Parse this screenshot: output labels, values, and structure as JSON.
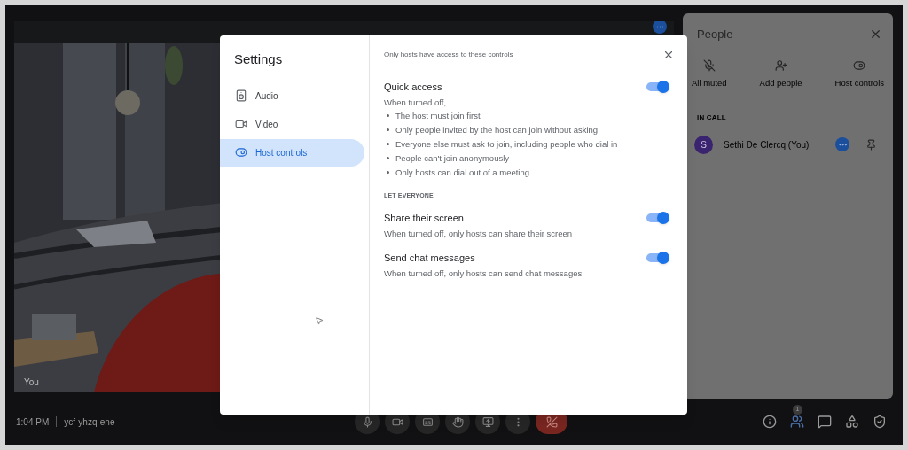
{
  "meeting": {
    "time": "1:04 PM",
    "code": "ycf-yhzq-ene",
    "self_label": "You",
    "people_count": "1"
  },
  "people_panel": {
    "title": "People",
    "actions": [
      {
        "label": "All muted",
        "kind": "muted"
      },
      {
        "label": "Add people",
        "kind": "add"
      },
      {
        "label": "Host controls",
        "kind": "host"
      }
    ],
    "section": "IN CALL",
    "participants": [
      {
        "initial": "S",
        "name": "Sethi De Clercq (You)"
      }
    ]
  },
  "settings": {
    "title": "Settings",
    "nav": [
      {
        "label": "Audio",
        "kind": "audio",
        "selected": false
      },
      {
        "label": "Video",
        "kind": "video",
        "selected": false
      },
      {
        "label": "Host controls",
        "kind": "host",
        "selected": true
      }
    ],
    "note": "Only hosts have access to these controls",
    "quick_access": {
      "title": "Quick access",
      "on": true,
      "intro": "When turned off,",
      "bullets": [
        "The host must join first",
        "Only people invited by the host can join without asking",
        "Everyone else must ask to join, including people who dial in",
        "People can't join anonymously",
        "Only hosts can dial out of a meeting"
      ]
    },
    "section": "LET EVERYONE",
    "options": [
      {
        "title": "Share their screen",
        "description": "When turned off, only hosts can share their screen",
        "on": true
      },
      {
        "title": "Send chat messages",
        "description": "When turned off, only hosts can send chat messages",
        "on": true
      }
    ]
  }
}
